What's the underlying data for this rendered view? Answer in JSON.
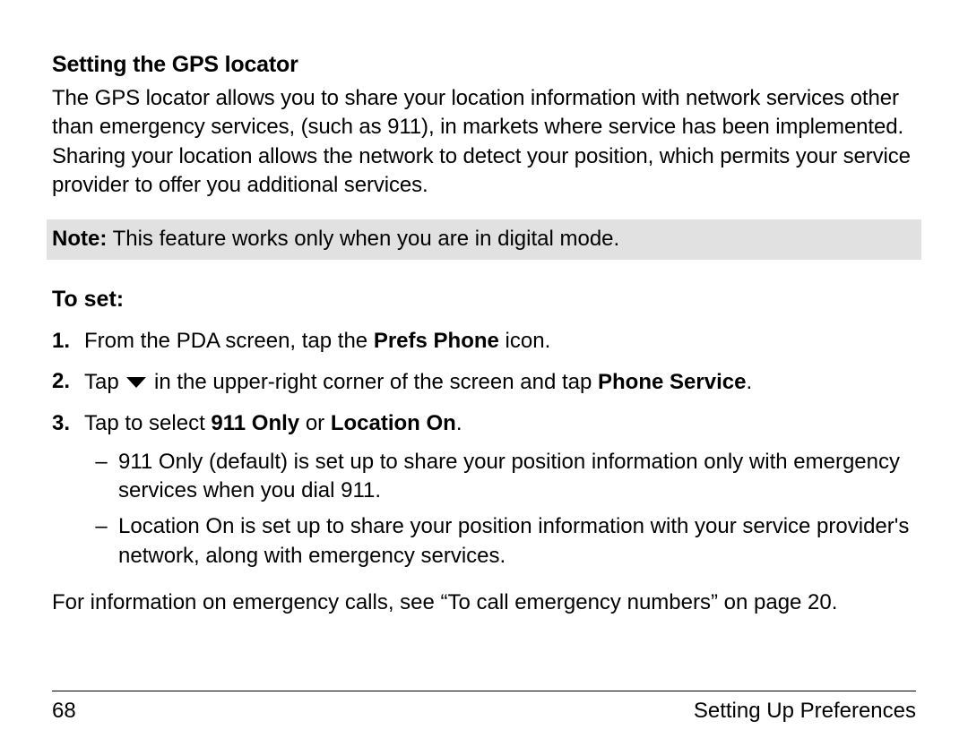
{
  "heading": "Setting the GPS locator",
  "intro": "The GPS locator allows you to share your location information with network services other than emergency services, (such as 911), in markets where service has been implemented. Sharing your location allows the network to detect your position, which permits your service provider to offer you additional services.",
  "note_label": "Note:",
  "note_text": " This feature works only when you are in digital mode.",
  "subheading": "To set:",
  "steps": [
    {
      "num": "1.",
      "pre": "From the PDA screen, tap the ",
      "bold": "Prefs Phone",
      "post": " icon."
    },
    {
      "num": "2.",
      "pre": "Tap ",
      "has_icon": true,
      "mid": " in the upper-right corner of the screen and tap ",
      "bold": "Phone Service",
      "post": "."
    },
    {
      "num": "3.",
      "pre": "Tap to select ",
      "bold": "911 Only",
      "mid2": " or ",
      "bold2": "Location On",
      "post": "."
    }
  ],
  "bullets": [
    "911 Only (default) is set up to share your position information only with emergency services when you dial 911.",
    "Location On is set up to share your position information with your service provider's network, along with emergency services."
  ],
  "refer": "For information on emergency calls, see “To call emergency numbers” on page 20.",
  "page_number": "68",
  "section_title": "Setting Up Preferences"
}
